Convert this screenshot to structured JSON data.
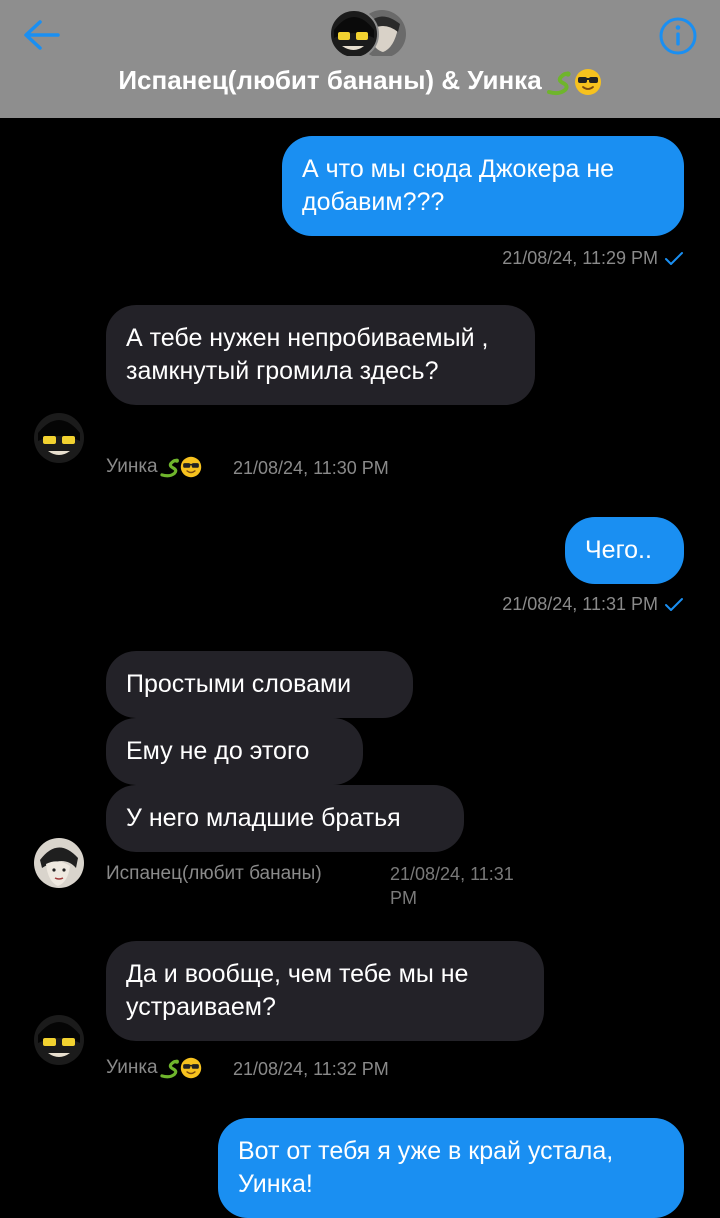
{
  "header": {
    "title": "Испанец(любит бананы)  & Уинка",
    "back_icon": "arrow-left-icon",
    "info_icon": "info-icon",
    "accent_color": "#1a8ff2",
    "background_color": "#8e8e8e"
  },
  "messages": [
    {
      "id": "m1",
      "direction": "outgoing",
      "text": "А что мы сюда Джокера не добавим???",
      "timestamp": "21/08/24, 11:29 PM",
      "status": "sent"
    },
    {
      "id": "m2",
      "direction": "incoming",
      "sender": "Уинка",
      "text": "А тебе нужен непробиваемый , замкнутый громила здесь?",
      "timestamp": "21/08/24, 11:30 PM"
    },
    {
      "id": "m3",
      "direction": "outgoing",
      "text": "Чего..",
      "timestamp": "21/08/24, 11:31 PM",
      "status": "sent"
    },
    {
      "id": "m4",
      "direction": "incoming",
      "sender": "Испанец(любит бананы)",
      "texts": [
        "Простыми словами",
        "Ему не до этого",
        "У него младшие братья"
      ],
      "timestamp_line1": "21/08/24, 11:31",
      "timestamp_line2": "PM"
    },
    {
      "id": "m5",
      "direction": "incoming",
      "sender": "Уинка",
      "text": "Да и вообще, чем тебе  мы не устраиваем?",
      "timestamp": "21/08/24, 11:32 PM"
    },
    {
      "id": "m6",
      "direction": "outgoing",
      "text": "Вот от тебя я уже в край устала, Уинка!"
    }
  ]
}
